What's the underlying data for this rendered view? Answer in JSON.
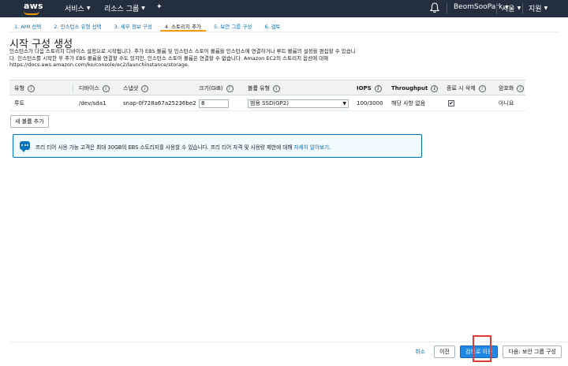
{
  "topnav": {
    "logo_text": "aws",
    "services": "서비스",
    "resource_groups": "리소스 그룹",
    "user": "BeomSooPark",
    "region": "서울",
    "support": "지원",
    "bg_color": "#232f3e",
    "accent": "#ff9900"
  },
  "wizard": {
    "steps": [
      {
        "label": "1. AMI 선택",
        "active": false
      },
      {
        "label": "2. 인스턴스 유형 선택",
        "active": false
      },
      {
        "label": "3. 세부 정보 구성",
        "active": false
      },
      {
        "label": "4. 스토리지 추가",
        "active": true
      },
      {
        "label": "5. 보안 그룹 구성",
        "active": false
      },
      {
        "label": "6. 검토",
        "active": false
      }
    ]
  },
  "page": {
    "title": "시작 구성 생성",
    "description_line1": "인스턴스가 다음 스토리지 디바이스 설정으로 시작됩니다. 추가 EBS 볼륨 및 인스턴스 스토어 볼륨을 인스턴스에 연결하거나 루트 볼륨의 설정을 편집할 수 있습니",
    "description_line2": "다. 인스턴스를 시작한 후 추가 EBS 볼륨을 연결할 수도 있지만, 인스턴스 스토어 볼륨은 연결할 수 없습니다. Amazon EC2의 스토리지 옵션에 대해",
    "description_line3": "https://docs.aws.amazon.com/ko/console/ec2/launchinstance/storage."
  },
  "table": {
    "headers": {
      "type": "유형",
      "device": "디바이스",
      "snapshot": "스냅샷",
      "size": "크기(GiB)",
      "volume_type": "볼륨 유형",
      "iops": "IOPS",
      "throughput": "Throughput",
      "delete_on_term": "종료 시 삭제",
      "encryption": "암호화"
    },
    "rows": [
      {
        "type": "루트",
        "device": "/dev/sda1",
        "snapshot": "snap-0f728a67a25236be2",
        "size": "8",
        "volume_type": "범용 SSD(GP2)",
        "iops": "100/3000",
        "throughput": "해당 사항 없음",
        "delete_on_term": true,
        "encryption": "아니요"
      }
    ]
  },
  "add_volume_label": "새 볼륨 추가",
  "info": {
    "message": "프리 티어 사용 가능 고객은 최대 30GB의 EBS 스토리지를 사용할 수 있습니다. 프리 티어 자격 및 사용량 제한에 대해 ",
    "link": "자세히 알아보기",
    "suffix": "."
  },
  "footer": {
    "cancel": "취소",
    "previous": "이전",
    "review": "검토로 이동",
    "next": "다음: 보안 그룹 구성",
    "primary_color": "#1e88e5"
  }
}
